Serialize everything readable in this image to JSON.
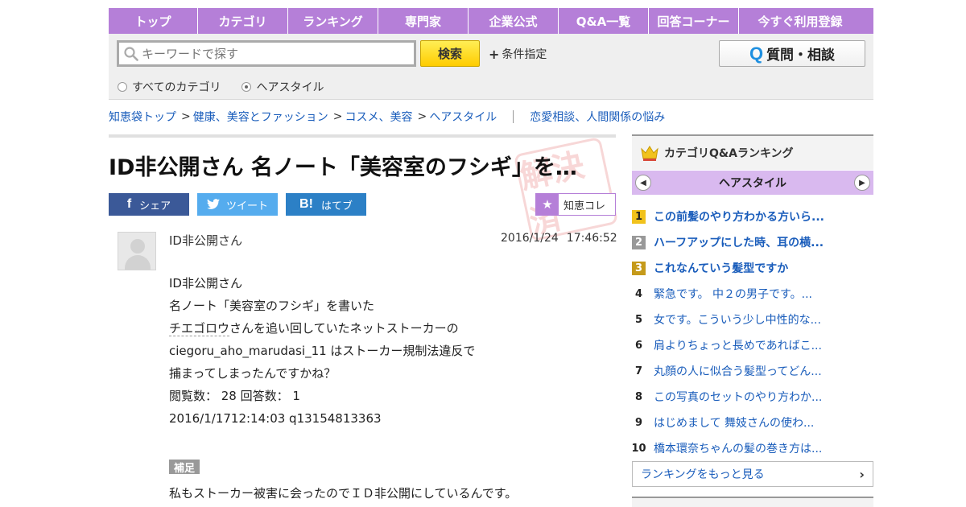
{
  "nav": {
    "items": [
      "トップ",
      "カテゴリ",
      "ランキング",
      "専門家",
      "企業公式",
      "Q&A一覧",
      "回答コーナー",
      "今すぐ利用登録"
    ]
  },
  "search": {
    "placeholder": "キーワードで探す",
    "button": "検索",
    "conditions": "条件指定",
    "ask_button": "質問・相談",
    "ask_icon_letter": "Q",
    "radio_all": "すべてのカテゴリ",
    "radio_current": "ヘアスタイル",
    "selected": "ヘアスタイル"
  },
  "breadcrumb": {
    "items": [
      "知恵袋トップ",
      "健康、美容とファッション",
      "コスメ、美容",
      "ヘアスタイル"
    ],
    "separator": ">",
    "related": "恋愛相談、人間関係の悩み"
  },
  "question": {
    "title": "ID非公開さん 名ノート「美容室のフシギ」を…",
    "stamp_text": "解決済",
    "share_facebook": "シェア",
    "share_twitter": "ツイート",
    "share_hatena": "はてブ",
    "hatena_icon": "B!",
    "collect": "知恵コレ",
    "user": "ID非公開さん",
    "date": "2016/1/24",
    "time": "17:46:52",
    "body_lines": [
      "ID非公開さん",
      "名ノート「美容室のフシギ」を書いた",
      "さんを追い回していたネットストーカーの",
      "ciegoru_aho_marudasi_11 はストーカー規制法違反で",
      "捕まってしまったんですかね？",
      "閲覧数： 28 回答数： 1",
      "2016/1/1712:14:03 q13154813363"
    ],
    "linked_user": "チエゴロウ",
    "supplement_label": "補足",
    "supplement_text": "私もストーカー被害に会ったのでＩＤ非公開にしているんです。"
  },
  "sidebar": {
    "heading": "カテゴリQ&Aランキング",
    "category": "ヘアスタイル",
    "rankings": [
      {
        "rank": "1",
        "title": "この前髪のやり方わかる方いら..."
      },
      {
        "rank": "2",
        "title": "ハーフアップにした時、耳の横..."
      },
      {
        "rank": "3",
        "title": "これなんていう髪型ですか"
      },
      {
        "rank": "4",
        "title": "緊急です。 中２の男子です。..."
      },
      {
        "rank": "5",
        "title": "女です。こういう少し中性的な..."
      },
      {
        "rank": "6",
        "title": "肩よりちょっと長めであればこ..."
      },
      {
        "rank": "7",
        "title": "丸顔の人に似合う髪型ってどん..."
      },
      {
        "rank": "8",
        "title": "この写真のセットのやり方わか..."
      },
      {
        "rank": "9",
        "title": "はじめまして 舞妓さんの使わ..."
      },
      {
        "rank": "10",
        "title": "橋本環奈ちゃんの髪の巻き方は..."
      }
    ],
    "more": "ランキングをもっと見る"
  },
  "colors": {
    "nav_bg": "#b57fd8",
    "link": "#1a5dbb",
    "search_btn": "#ffdd33",
    "facebook": "#3b5998",
    "twitter": "#55acee",
    "hatena": "#2c80c6"
  },
  "icons": [
    "search-icon",
    "plus-icon",
    "facebook-icon",
    "twitter-icon",
    "hatena-icon",
    "star-icon",
    "crown-icon",
    "chevron-left-icon",
    "chevron-right-icon",
    "avatar-icon"
  ]
}
